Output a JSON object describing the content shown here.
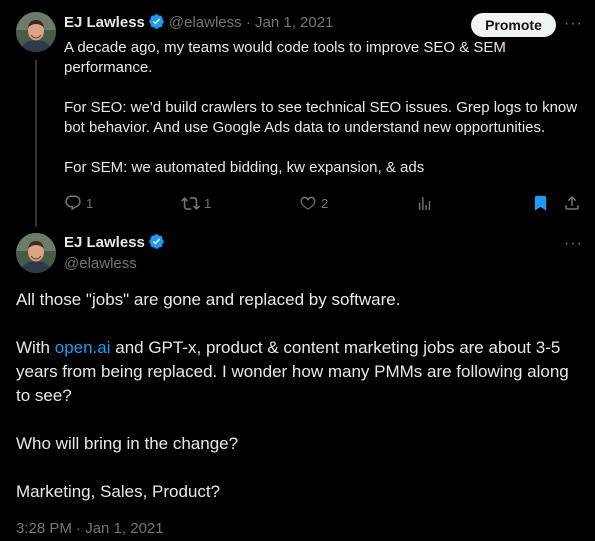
{
  "colors": {
    "accent": "#1d9bf0",
    "background": "#000000",
    "text": "#e7e9ea",
    "muted": "#71767b"
  },
  "parent_tweet": {
    "author_name": "EJ Lawless",
    "handle": "@elawless",
    "separator": "·",
    "date": "Jan 1, 2021",
    "promote_label": "Promote",
    "more_label": "···",
    "paragraphs": [
      "A decade ago, my teams would code tools to improve SEO & SEM performance.",
      "For SEO: we'd build crawlers to see technical SEO issues. Grep logs to know bot behavior. And use Google Ads data to understand new opportunities.",
      "For SEM: we automated bidding, kw expansion, & ads"
    ],
    "actions": {
      "reply_count": "1",
      "retweet_count": "1",
      "like_count": "2",
      "icons": [
        "reply-icon",
        "retweet-icon",
        "like-icon",
        "analytics-icon",
        "bookmark-icon",
        "share-icon"
      ]
    }
  },
  "main_tweet": {
    "author_name": "EJ Lawless",
    "handle": "@elawless",
    "more_label": "···",
    "para1": "All those \"jobs\" are gone and replaced by software.",
    "para2_before": "With ",
    "para2_link": "open.ai",
    "para2_after": " and GPT-x, product & content marketing jobs are about 3-5 years from being replaced. I wonder how many PMMs are following along to see?",
    "para3": "Who will bring in the change?",
    "para4": "Marketing, Sales, Product?",
    "timestamp": "3:28 PM · Jan 1, 2021"
  }
}
